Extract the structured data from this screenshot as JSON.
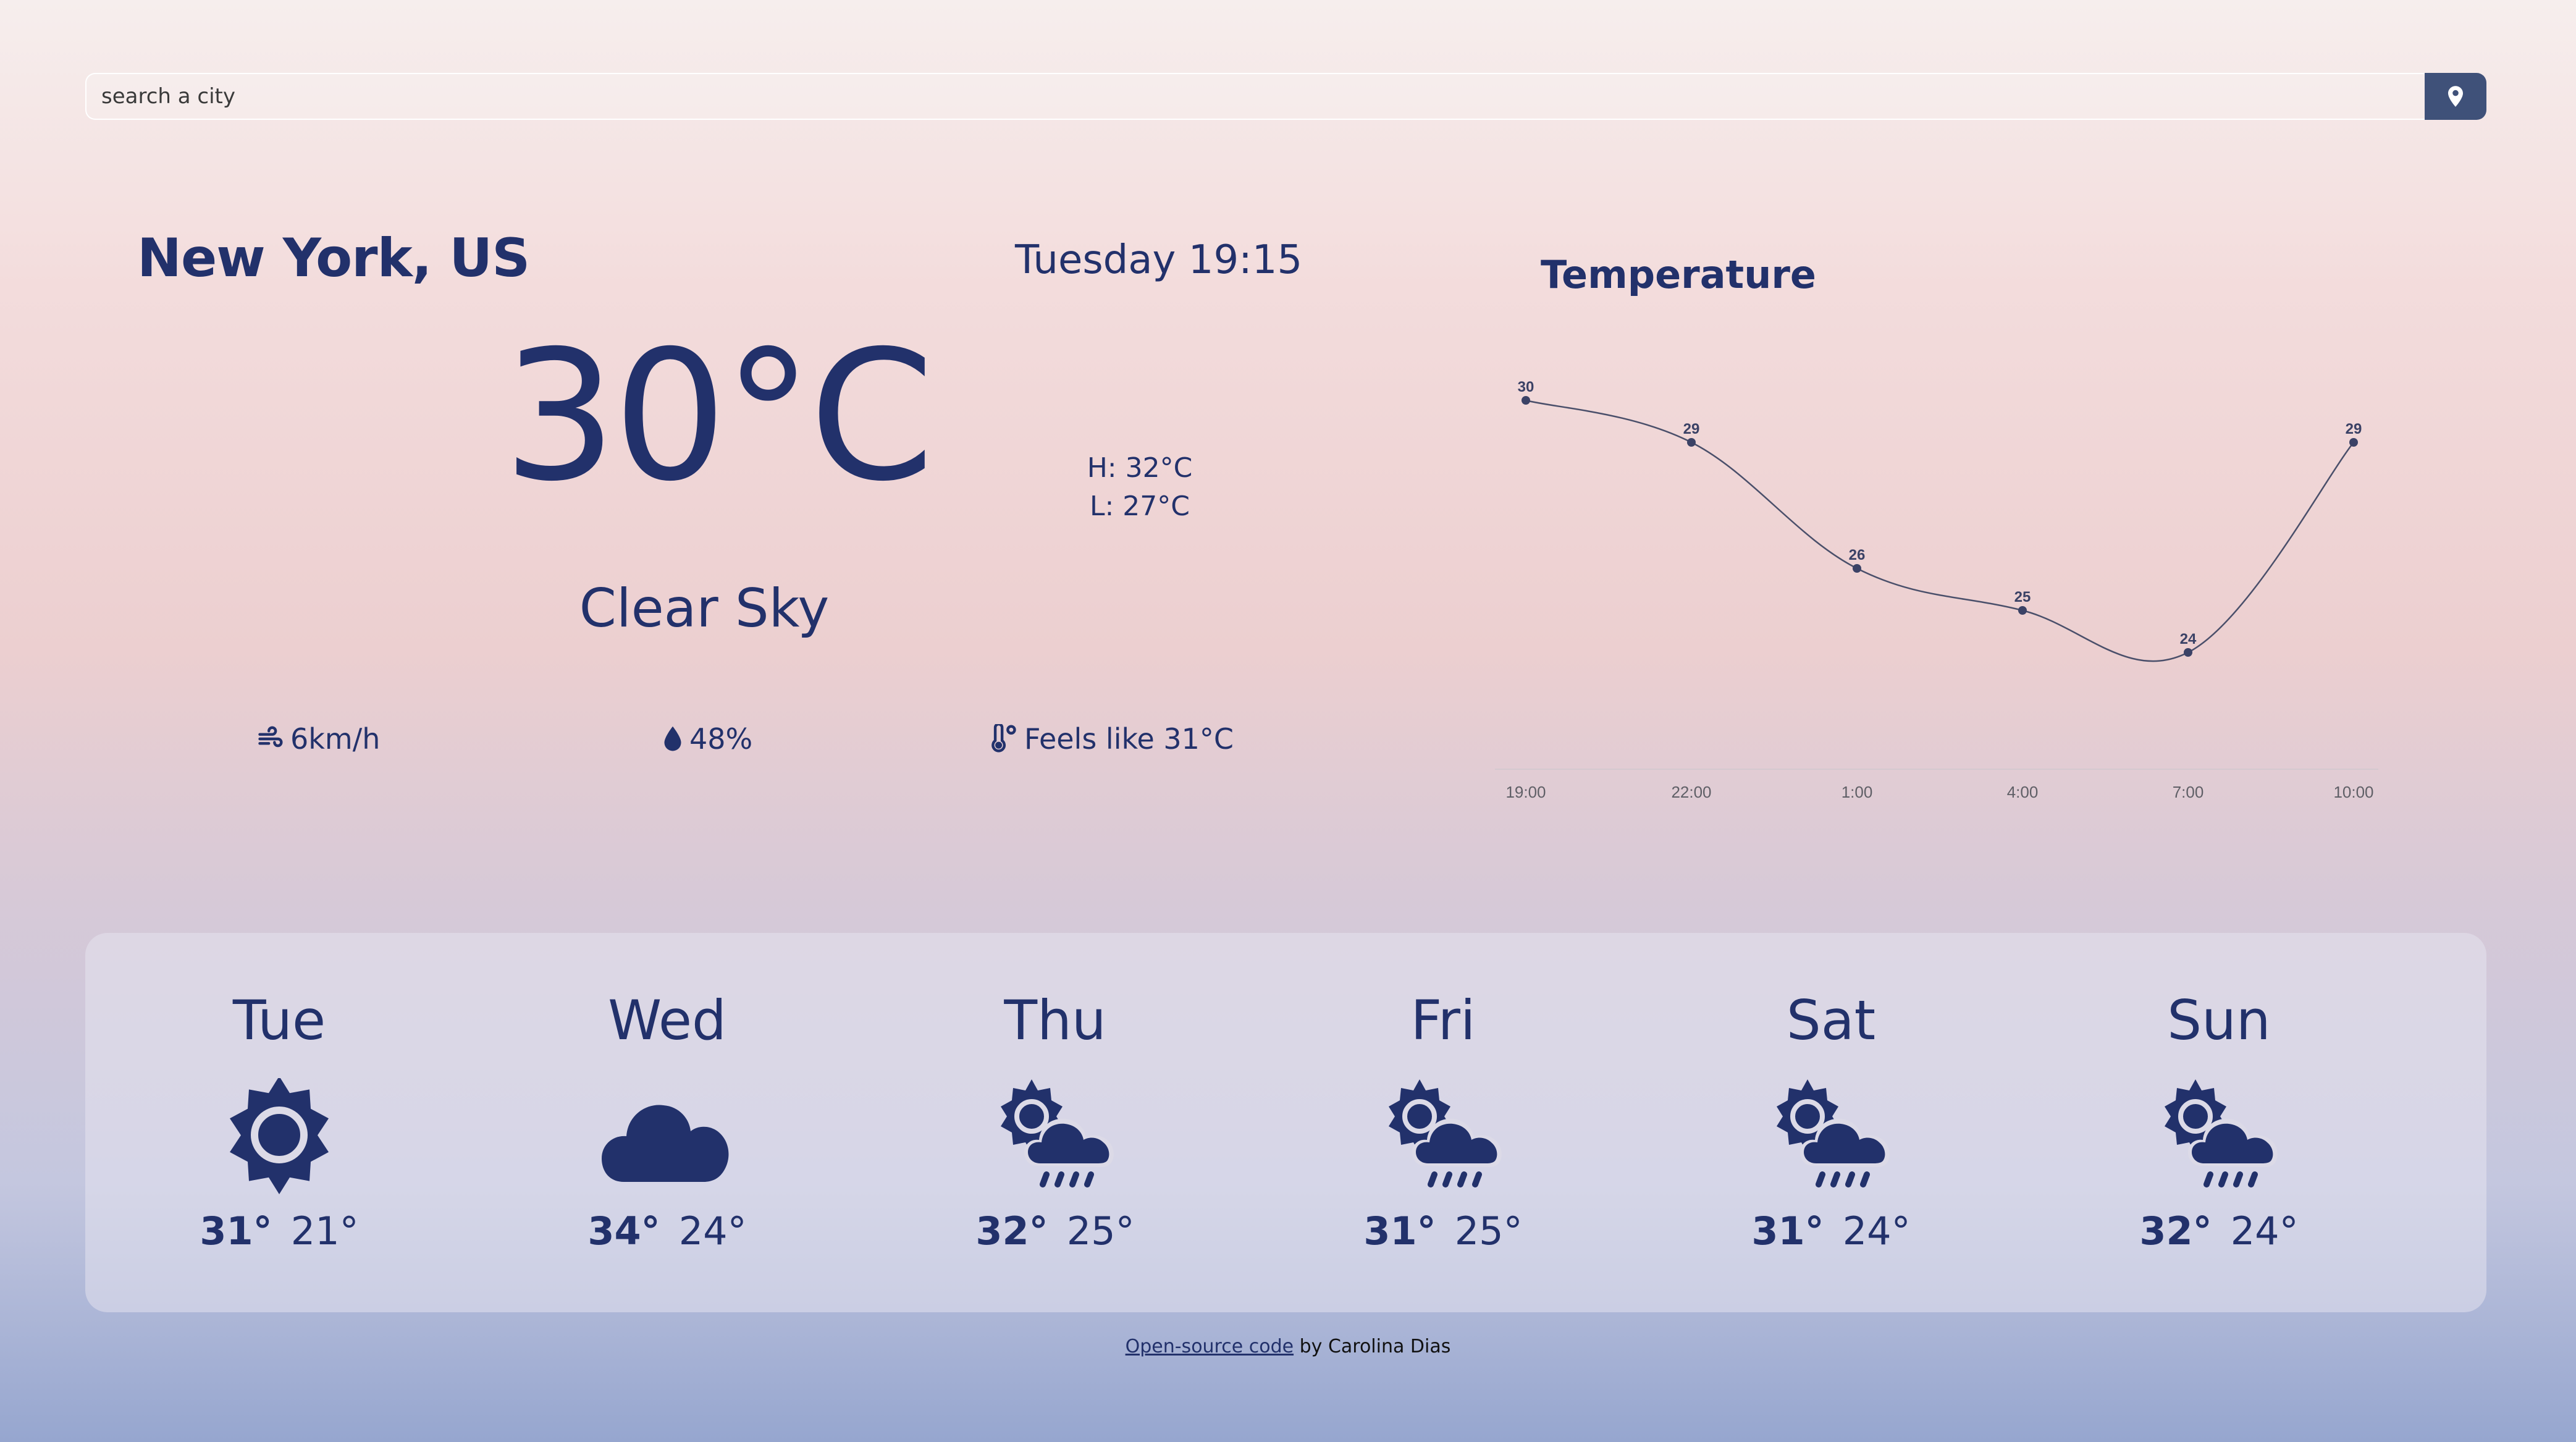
{
  "search": {
    "placeholder": "search a city"
  },
  "current": {
    "city": "New York, US",
    "datetime": "Tuesday 19:15",
    "temperature": "30°C",
    "high": "H: 32°C",
    "low": "L: 27°C",
    "description": "Clear Sky",
    "wind": "6km/h",
    "humidity": "48%",
    "feels_like": "Feels like 31°C"
  },
  "chart_data": {
    "type": "line",
    "title": "Temperature",
    "x": [
      "19:00",
      "22:00",
      "1:00",
      "4:00",
      "7:00",
      "10:00"
    ],
    "series": [
      {
        "values": [
          30,
          29,
          26,
          25,
          24,
          29
        ]
      }
    ],
    "data_labels": [
      "30",
      "29",
      "26",
      "25",
      "24",
      "29"
    ],
    "ylim": [
      21,
      31
    ],
    "grid": false,
    "legend": "none"
  },
  "forecast": [
    {
      "day": "Tue",
      "max": "31°",
      "min": "21°",
      "icon": "sun-icon"
    },
    {
      "day": "Wed",
      "max": "34°",
      "min": "24°",
      "icon": "cloud-icon"
    },
    {
      "day": "Thu",
      "max": "32°",
      "min": "25°",
      "icon": "sun-cloud-rain-icon"
    },
    {
      "day": "Fri",
      "max": "31°",
      "min": "25°",
      "icon": "sun-cloud-rain-icon"
    },
    {
      "day": "Sat",
      "max": "31°",
      "min": "24°",
      "icon": "sun-cloud-rain-icon"
    },
    {
      "day": "Sun",
      "max": "32°",
      "min": "24°",
      "icon": "sun-cloud-rain-icon"
    }
  ],
  "footer": {
    "link_text": "Open-source code",
    "suffix": " by Carolina Dias"
  },
  "colors": {
    "primary": "#22316b",
    "button": "#3f5179"
  }
}
